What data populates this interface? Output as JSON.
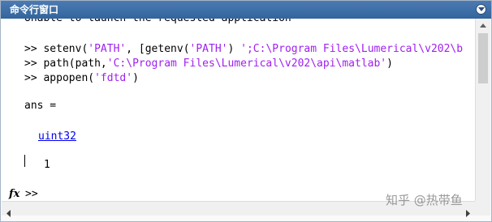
{
  "window": {
    "title": "命令行窗口"
  },
  "console": {
    "clipped_top_line": "Unable to launch the requested application",
    "commands": [
      {
        "prompt": ">> ",
        "code_before": "setenv(",
        "str1": "'PATH'",
        "code_mid": ", [getenv(",
        "str2": "'PATH'",
        "code_mid2": ") ",
        "str3": "';C:\\Program Files\\Lumerical\\v202\\b"
      },
      {
        "prompt": ">> ",
        "code_before": "path(path,",
        "str1": "'C:\\Program Files\\Lumerical\\v202\\api\\matlab'",
        "code_after": ")"
      },
      {
        "prompt": ">> ",
        "code_before": "appopen(",
        "str1": "'fdtd'",
        "code_after": ")"
      }
    ],
    "ans_label": "ans =",
    "ans_type": "uint32",
    "ans_value": "1",
    "prompt": ">>"
  },
  "watermark": "知乎 @热带鱼",
  "icons": {
    "menu": "chevron-down-icon",
    "function": "fx-icon",
    "scroll_left": "arrow-left-icon",
    "scroll_right": "arrow-right-icon",
    "scroll_up": "arrow-up-icon"
  }
}
